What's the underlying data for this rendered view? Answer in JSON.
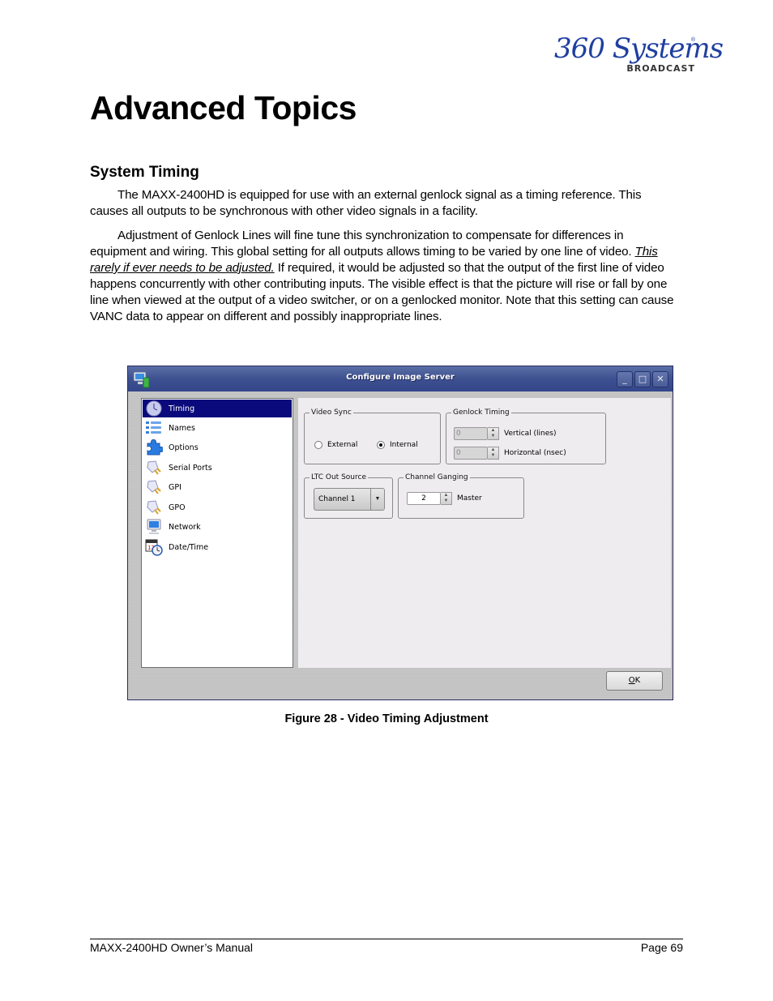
{
  "logo": {
    "script_text": "360 Systems",
    "registered_mark": "®",
    "subtext": "BROADCAST",
    "brand_color": "#1f3fa0"
  },
  "page": {
    "title": "Advanced Topics",
    "section_heading": "System Timing",
    "paragraph1": "The MAXX-2400HD is equipped for use with an external genlock signal as a timing reference. This causes all outputs to be synchronous with other video signals in a facility.",
    "paragraph2_before": "Adjustment of Genlock Lines will fine tune this synchronization to compensate for differences in equipment and wiring. This global setting for all outputs allows timing to be varied by one line of video.  ",
    "paragraph2_emphasis": "This rarely if ever needs to be adjusted.",
    "paragraph2_after": " If required, it would be adjusted so that the output of the first line of video happens concurrently with other contributing inputs.  The visible effect is that the picture will rise or fall by one line when viewed at the output of a video switcher, or on a genlocked monitor.  Note that this setting can cause VANC data to appear on different and possibly inappropriate lines.",
    "figure_caption": "Figure 28 - Video Timing Adjustment"
  },
  "dialog": {
    "title": "Configure Image Server",
    "app_icon": "server-monitor-icon",
    "window_buttons": {
      "minimize": "_",
      "maximize": "□",
      "close": "✕"
    },
    "nav_items": [
      {
        "label": "Timing",
        "icon": "clock-icon",
        "selected": true
      },
      {
        "label": "Names",
        "icon": "list-icon",
        "selected": false
      },
      {
        "label": "Options",
        "icon": "puzzle-icon",
        "selected": false
      },
      {
        "label": "Serial Ports",
        "icon": "plug-icon",
        "selected": false
      },
      {
        "label": "GPI",
        "icon": "plug-icon",
        "selected": false
      },
      {
        "label": "GPO",
        "icon": "plug-icon",
        "selected": false
      },
      {
        "label": "Network",
        "icon": "monitor-icon",
        "selected": false
      },
      {
        "label": "Date/Time",
        "icon": "calendar-clock-icon",
        "selected": false
      }
    ],
    "video_sync": {
      "legend": "Video Sync",
      "options": [
        "External",
        "Internal"
      ],
      "selected": "Internal"
    },
    "genlock_timing": {
      "legend": "Genlock Timing",
      "vertical_value": "0",
      "vertical_label": "Vertical (lines)",
      "horizontal_value": "0",
      "horizontal_label": "Horizontal (nsec)"
    },
    "ltc_out_source": {
      "legend": "LTC Out Source",
      "selected": "Channel 1"
    },
    "channel_ganging": {
      "legend": "Channel Ganging",
      "value": "2",
      "label": "Master"
    },
    "ok_button": {
      "accel": "O",
      "rest": "K"
    }
  },
  "footer": {
    "left": "MAXX-2400HD Owner’s Manual",
    "right": "Page 69"
  }
}
